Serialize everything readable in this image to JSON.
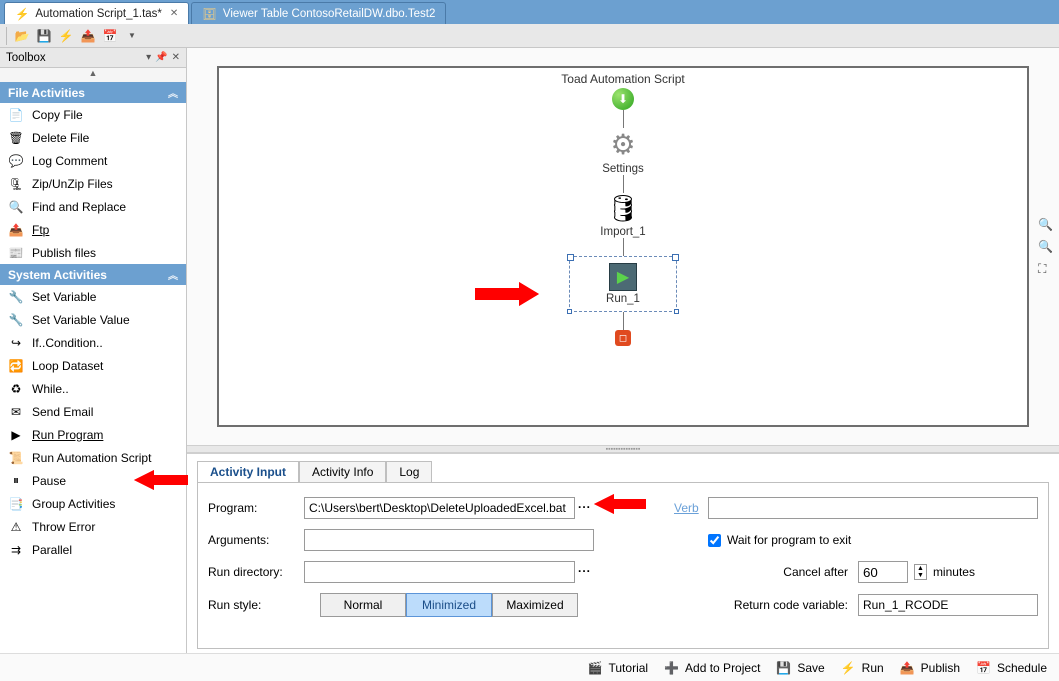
{
  "tabs": [
    {
      "label": "Automation Script_1.tas*",
      "active": true
    },
    {
      "label": "Viewer Table ContosoRetailDW.dbo.Test2",
      "active": false
    }
  ],
  "toolbox": {
    "title": "Toolbox",
    "sections": [
      {
        "id": "file",
        "title": "File Activities",
        "items": [
          {
            "label": "Copy File",
            "icon": "📄"
          },
          {
            "label": "Delete File",
            "icon": "🗑"
          },
          {
            "label": "Log Comment",
            "icon": "💬"
          },
          {
            "label": "Zip/UnZip Files",
            "icon": "🗜"
          },
          {
            "label": "Find and Replace",
            "icon": "🔍"
          },
          {
            "label": "Ftp",
            "icon": "📤",
            "underline": true
          },
          {
            "label": "Publish files",
            "icon": "📰"
          }
        ]
      },
      {
        "id": "system",
        "title": "System Activities",
        "items": [
          {
            "label": "Set Variable",
            "icon": "🔧"
          },
          {
            "label": "Set Variable Value",
            "icon": "🔧"
          },
          {
            "label": "If..Condition..",
            "icon": "↪"
          },
          {
            "label": "Loop Dataset",
            "icon": "🔁"
          },
          {
            "label": "While..",
            "icon": "♻"
          },
          {
            "label": "Send Email",
            "icon": "✉"
          },
          {
            "label": "Run Program",
            "icon": "▶",
            "underline": true
          },
          {
            "label": "Run Automation Script",
            "icon": "📜"
          },
          {
            "label": "Pause",
            "icon": "⏸"
          },
          {
            "label": "Group Activities",
            "icon": "📑"
          },
          {
            "label": "Throw Error",
            "icon": "⚠"
          },
          {
            "label": "Parallel",
            "icon": "⇉"
          }
        ]
      }
    ]
  },
  "canvas": {
    "title": "Toad Automation Script",
    "nodes": {
      "settings": "Settings",
      "import": "Import_1",
      "run": "Run_1"
    }
  },
  "propTabs": {
    "activity_input": "Activity Input",
    "activity_info": "Activity Info",
    "log": "Log"
  },
  "form": {
    "program_label": "Program:",
    "program_value": "C:\\Users\\bert\\Desktop\\DeleteUploadedExcel.bat",
    "verb_label": "Verb",
    "verb_value": "",
    "arguments_label": "Arguments:",
    "arguments_value": "",
    "wait_label": "Wait for program to exit",
    "wait_checked": true,
    "rundir_label": "Run directory:",
    "rundir_value": "",
    "cancel_after_label": "Cancel after",
    "cancel_after_value": "60",
    "minutes_label": "minutes",
    "runstyle_label": "Run style:",
    "runstyle": {
      "normal": "Normal",
      "minimized": "Minimized",
      "maximized": "Maximized",
      "selected": "minimized"
    },
    "rcode_label": "Return code variable:",
    "rcode_value": "Run_1_RCODE"
  },
  "footer": {
    "tutorial": "Tutorial",
    "add": "Add to Project",
    "save": "Save",
    "run": "Run",
    "publish": "Publish",
    "schedule": "Schedule"
  }
}
